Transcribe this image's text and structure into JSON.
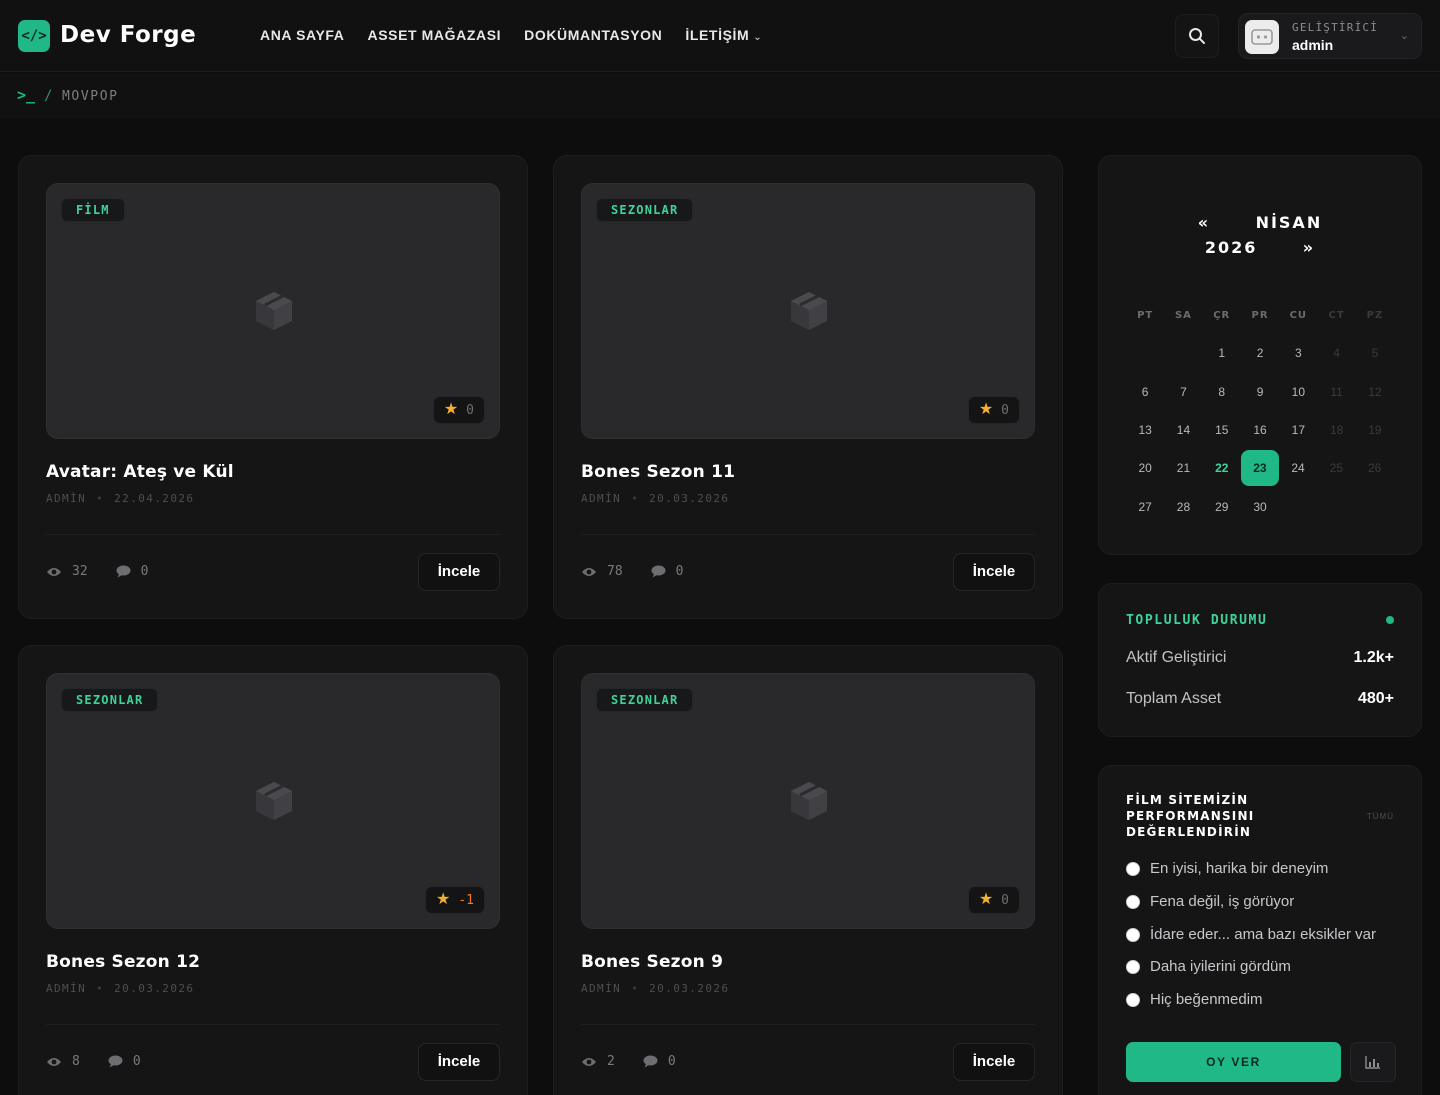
{
  "header": {
    "logo_icon": "</>",
    "brand": "Dev Forge",
    "nav": [
      {
        "label": "ANA SAYFA"
      },
      {
        "label": "ASSET MAĞAZASI"
      },
      {
        "label": "DOKÜMANTASYON"
      },
      {
        "label": "İLETİŞİM"
      }
    ],
    "user": {
      "role": "GELİŞTİRİCİ",
      "name": "admin"
    }
  },
  "breadcrumb": {
    "prompt": ">_",
    "separator": "/",
    "current": "MOVPOP"
  },
  "cards": [
    {
      "badge": "FİLM",
      "rating": "0",
      "title": "Avatar: Ateş ve Kül",
      "author": "ADMİN",
      "date": "22.04.2026",
      "views": "32",
      "comments": "0",
      "button": "İncele"
    },
    {
      "badge": "SEZONLAR",
      "rating": "0",
      "title": "Bones Sezon 11",
      "author": "ADMİN",
      "date": "20.03.2026",
      "views": "78",
      "comments": "0",
      "button": "İncele"
    },
    {
      "badge": "SEZONLAR",
      "rating": "-1",
      "title": "Bones Sezon 12",
      "author": "ADMİN",
      "date": "20.03.2026",
      "views": "8",
      "comments": "0",
      "button": "İncele"
    },
    {
      "badge": "SEZONLAR",
      "rating": "0",
      "title": "Bones Sezon 9",
      "author": "ADMİN",
      "date": "20.03.2026",
      "views": "2",
      "comments": "0",
      "button": "İncele"
    }
  ],
  "calendar": {
    "prev": "«",
    "month": "NİSAN",
    "year": "2026",
    "next": "»",
    "weekdays": [
      "PT",
      "SA",
      "ÇR",
      "PR",
      "CU",
      "CT",
      "PZ"
    ],
    "weeks": [
      [
        "",
        "",
        "1",
        "2",
        "3",
        "4",
        "5"
      ],
      [
        "6",
        "7",
        "8",
        "9",
        "10",
        "11",
        "12"
      ],
      [
        "13",
        "14",
        "15",
        "16",
        "17",
        "18",
        "19"
      ],
      [
        "20",
        "21",
        "22",
        "23",
        "24",
        "25",
        "26"
      ],
      [
        "27",
        "28",
        "29",
        "30",
        "",
        "",
        ""
      ]
    ],
    "today": "22",
    "selected": "23"
  },
  "community": {
    "title": "TOPLULUK DURUMU",
    "rows": [
      {
        "label": "Aktif Geliştirici",
        "value": "1.2k+"
      },
      {
        "label": "Toplam Asset",
        "value": "480+"
      }
    ]
  },
  "poll": {
    "title": "FİLM SİTEMİZİN PERFORMANSINI DEĞERLENDİRİN",
    "all_label": "TÜMÜ",
    "options": [
      "En iyisi, harika bir deneyim",
      "Fena değil, iş görüyor",
      "İdare eder... ama bazı eksikler var",
      "Daha iyilerini gördüm",
      "Hiç beğenmedim"
    ],
    "vote_label": "OY VER"
  },
  "colors": {
    "accent": "#1fb886",
    "accent_text": "#3ed39a",
    "star": "#f5b02e",
    "negative": "#ee7a2e",
    "background": "#0d0d0e",
    "card": "#151516"
  }
}
